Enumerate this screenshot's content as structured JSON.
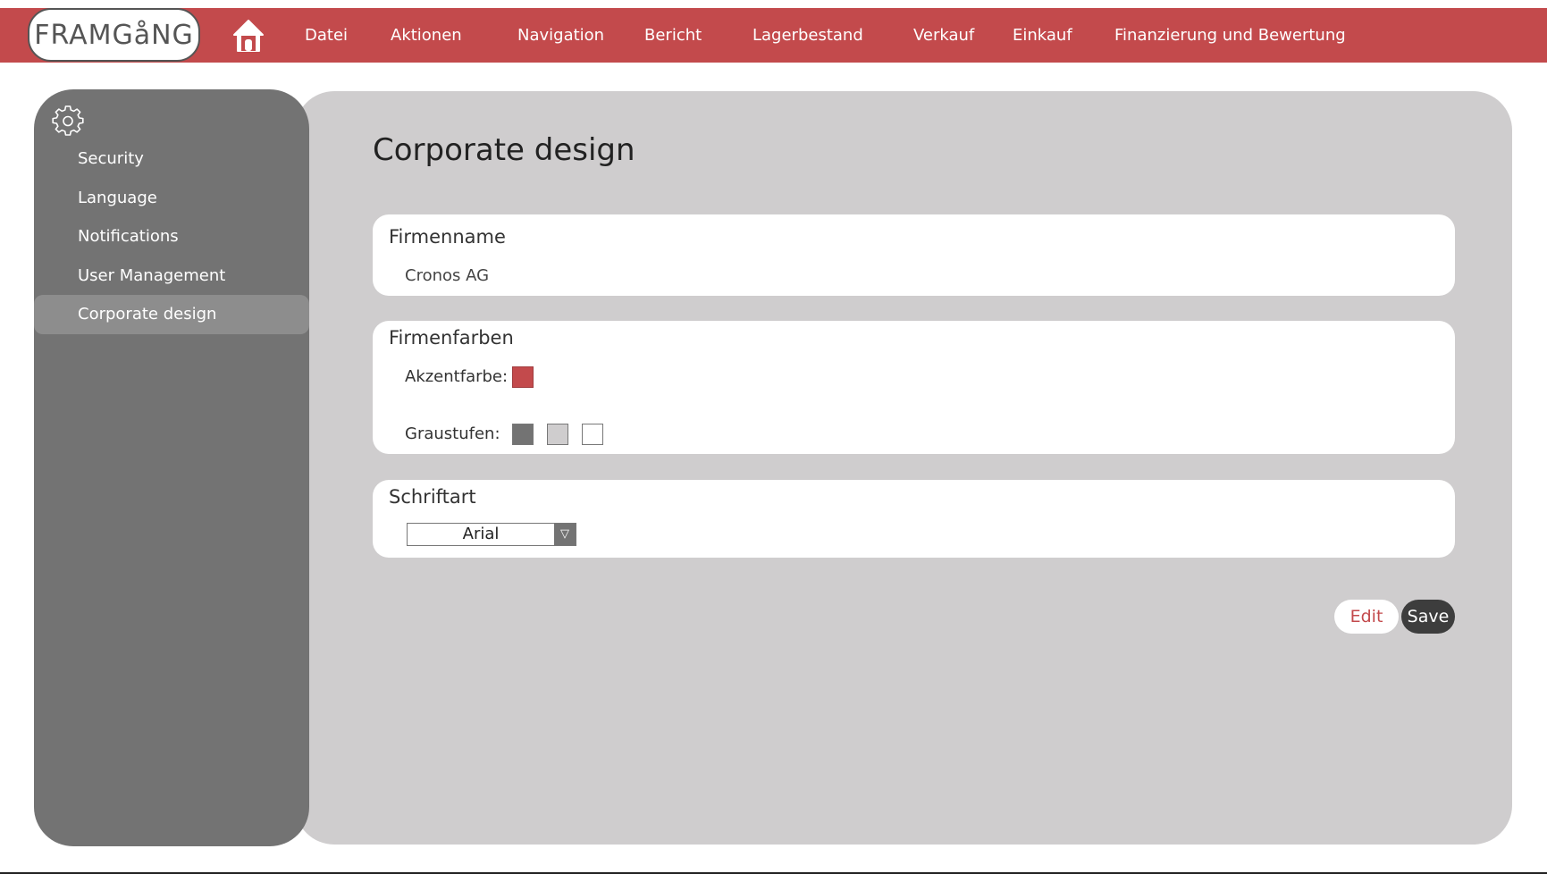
{
  "app": {
    "logo_text": "FRAMGåNG"
  },
  "topnav": {
    "home_icon": "house-icon",
    "items": [
      "Datei",
      "Aktionen",
      "Navigation",
      "Bericht",
      "Lagerbestand",
      "Verkauf",
      "Einkauf",
      "Finanzierung und Bewertung"
    ]
  },
  "sidebar": {
    "icon": "gear-icon",
    "items": [
      {
        "label": "Security"
      },
      {
        "label": "Language"
      },
      {
        "label": "Notifications"
      },
      {
        "label": "User Management"
      },
      {
        "label": "Corporate design",
        "active": true
      }
    ]
  },
  "main": {
    "title": "Corporate design",
    "company_name": {
      "title": "Firmenname",
      "value": "Cronos AG"
    },
    "company_colors": {
      "title": "Firmenfarben",
      "accent_label": "Akzentfarbe:",
      "accent_color": "#c34a4c",
      "grayscale_label": "Graustufen:",
      "grayscale_colors": [
        "#737373",
        "#cfcdce",
        "#ffffff"
      ]
    },
    "font": {
      "title": "Schriftart",
      "selected": "Arial",
      "arrow": "▽"
    },
    "buttons": {
      "edit": "Edit",
      "save": "Save"
    }
  },
  "colors": {
    "brand": "#c34a4c",
    "sidebar_bg": "#737373",
    "content_bg": "#cfcdce",
    "save_button_bg": "#3d3d3d"
  }
}
